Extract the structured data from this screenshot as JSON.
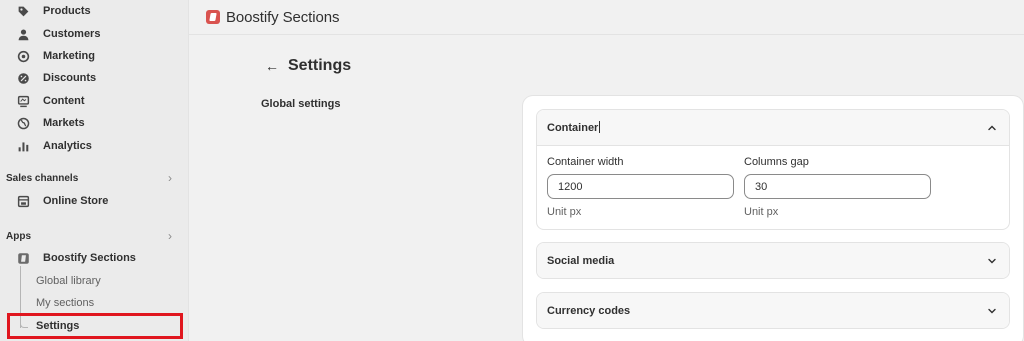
{
  "sidebar": {
    "nav": [
      {
        "label": "Products",
        "icon": "tag-icon"
      },
      {
        "label": "Customers",
        "icon": "person-icon"
      },
      {
        "label": "Marketing",
        "icon": "target-icon"
      },
      {
        "label": "Discounts",
        "icon": "discount-icon"
      },
      {
        "label": "Content",
        "icon": "content-icon"
      },
      {
        "label": "Markets",
        "icon": "globe-icon"
      },
      {
        "label": "Analytics",
        "icon": "bar-chart-icon"
      }
    ],
    "sales_channels": {
      "label": "Sales channels",
      "items": [
        {
          "label": "Online Store",
          "icon": "store-icon"
        }
      ]
    },
    "apps": {
      "label": "Apps",
      "app": {
        "label": "Boostify Sections",
        "icon": "app-icon"
      },
      "sub_items": [
        {
          "label": "Global library"
        },
        {
          "label": "My sections"
        },
        {
          "label": "Settings"
        }
      ]
    }
  },
  "topbar": {
    "title": "Boostify Sections"
  },
  "page": {
    "back_icon": "arrow-left-icon",
    "title": "Settings",
    "section_label": "Global settings"
  },
  "accordions": {
    "container": {
      "title": "Container",
      "expanded": true,
      "width_label": "Container width",
      "width_value": "1200",
      "width_help": "Unit px",
      "gap_label": "Columns gap",
      "gap_value": "30",
      "gap_help": "Unit px"
    },
    "social": {
      "title": "Social media",
      "expanded": false
    },
    "currency": {
      "title": "Currency codes",
      "expanded": false
    }
  },
  "colors": {
    "highlight": "#e0161e",
    "app_logo": "#d9534f"
  }
}
